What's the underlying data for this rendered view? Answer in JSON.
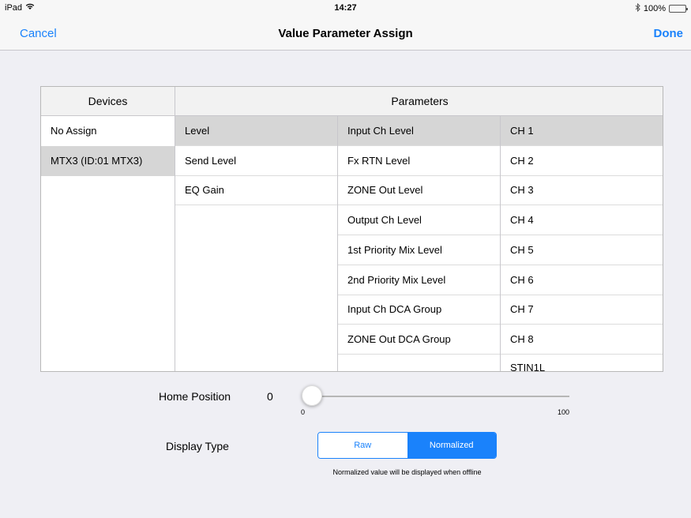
{
  "status_bar": {
    "device": "iPad",
    "time": "14:27",
    "battery": "100%",
    "battery_level": 1.0
  },
  "nav": {
    "cancel": "Cancel",
    "title": "Value Parameter Assign",
    "done": "Done"
  },
  "table": {
    "devices_header": "Devices",
    "parameters_header": "Parameters",
    "devices": [
      "No Assign",
      "MTX3 (ID:01 MTX3)"
    ],
    "categories": [
      "Level",
      "Send Level",
      "EQ Gain"
    ],
    "parameters": [
      "Input Ch Level",
      "Fx RTN Level",
      "ZONE Out Level",
      "Output Ch Level",
      "1st Priority Mix Level",
      "2nd Priority Mix Level",
      "Input Ch DCA Group",
      "ZONE Out DCA Group"
    ],
    "channels": [
      "CH 1",
      "CH 2",
      "CH 3",
      "CH 4",
      "CH 5",
      "CH 6",
      "CH 7",
      "CH 8",
      "STIN1L"
    ],
    "selected_device": "MTX3 (ID:01 MTX3)",
    "selected_category": "Level",
    "selected_parameter": "Input Ch Level",
    "selected_channel": "CH 1"
  },
  "home_position": {
    "label": "Home Position",
    "value": "0",
    "min": "0",
    "max": "100",
    "slider_fraction": 0.0
  },
  "display_type": {
    "label": "Display Type",
    "options": [
      "Raw",
      "Normalized"
    ],
    "selected": "Normalized",
    "note": "Normalized value will be displayed when offline"
  },
  "colors": {
    "accent": "#1a82fb",
    "selected_row": "#d6d6d6",
    "background": "#efeff4"
  }
}
